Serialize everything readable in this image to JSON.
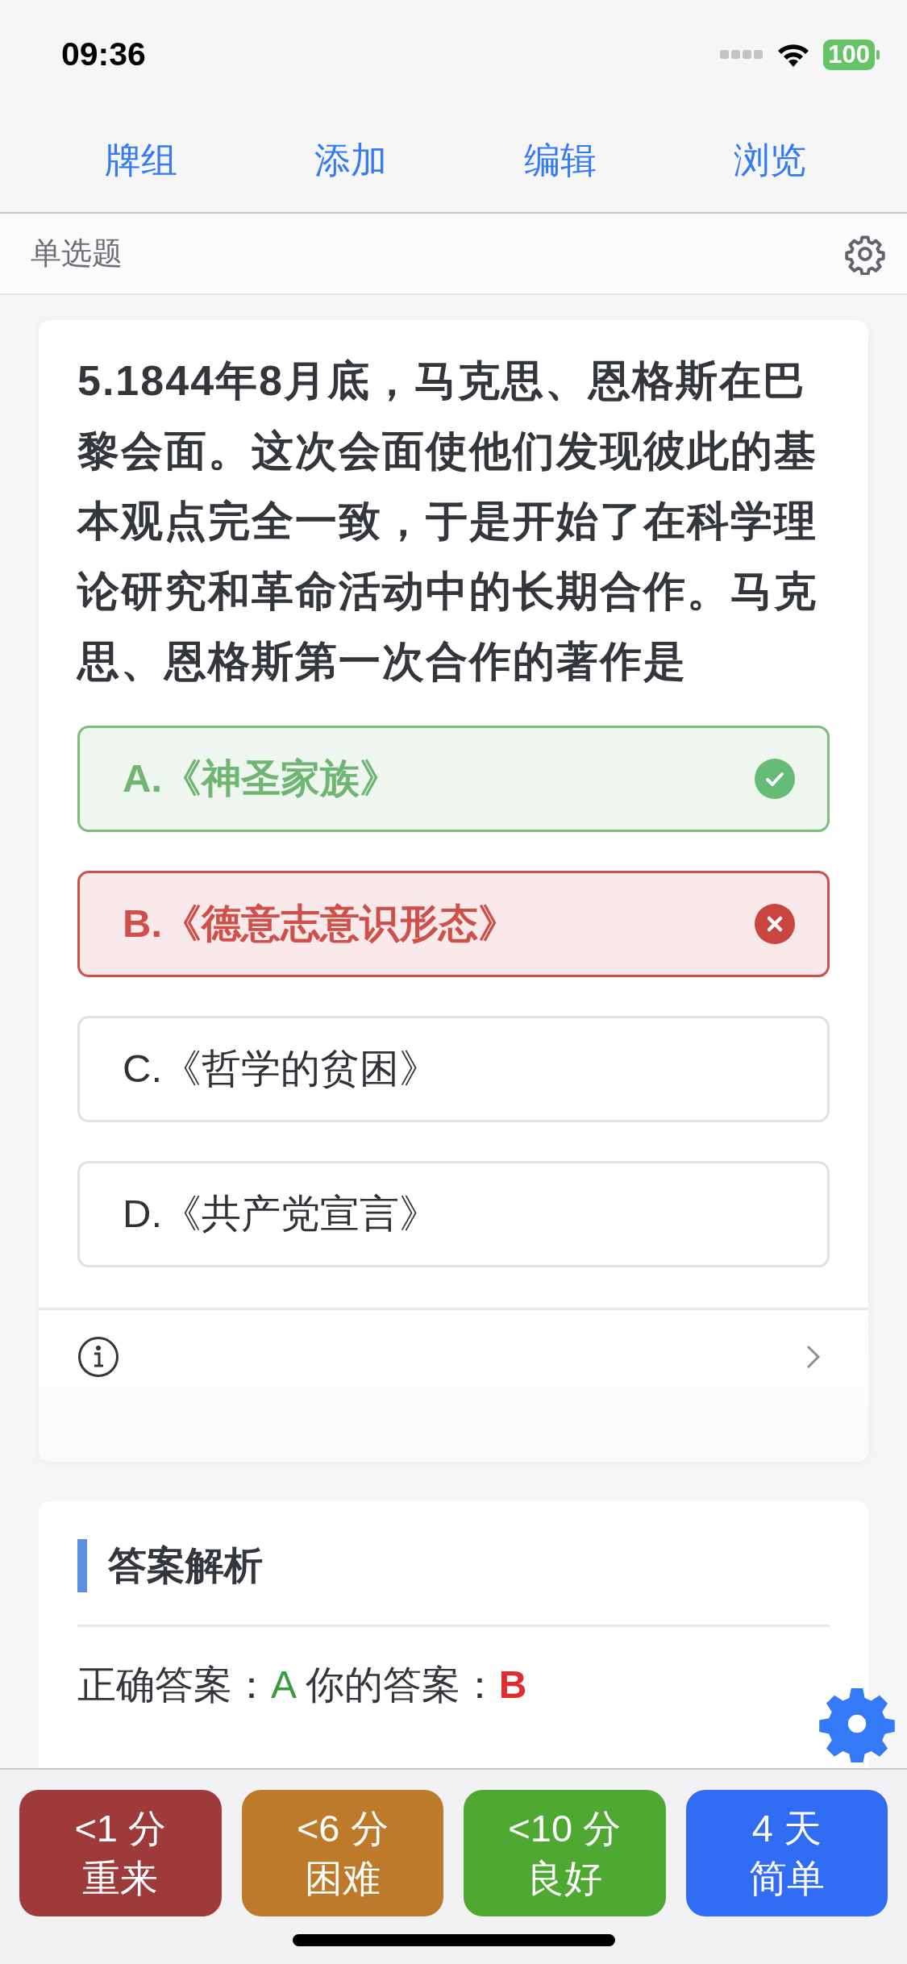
{
  "status_bar": {
    "time": "09:36",
    "battery": "100"
  },
  "nav": [
    {
      "label": "牌组"
    },
    {
      "label": "添加"
    },
    {
      "label": "编辑"
    },
    {
      "label": "浏览"
    }
  ],
  "subheader": {
    "title": "单选题"
  },
  "question": {
    "text": "5.1844年8月底，马克思、恩格斯在巴黎会面。这次会面使他们发现彼此的基本观点完全一致，于是开始了在科学理论研究和革命活动中的长期合作。马克思、恩格斯第一次合作的著作是",
    "options": [
      {
        "text": "A.《神圣家族》",
        "kind": "correct"
      },
      {
        "text": "B.《德意志意识形态》",
        "kind": "wrong"
      },
      {
        "text": "C.《哲学的贫困》",
        "kind": "plain"
      },
      {
        "text": "D.《共产党宣言》",
        "kind": "plain"
      }
    ]
  },
  "analysis": {
    "title": "答案解析",
    "correct_label": "正确答案：",
    "correct_value": "A",
    "yours_label": "你的答案：",
    "yours_value": "B"
  },
  "answer_buttons": [
    {
      "interval": "<1 分",
      "label": "重来",
      "color": "#9e3a3a"
    },
    {
      "interval": "<6 分",
      "label": "困难",
      "color": "#bd7a2a"
    },
    {
      "interval": "<10 分",
      "label": "良好",
      "color": "#4ea832"
    },
    {
      "interval": "4 天",
      "label": "简单",
      "color": "#316cf4"
    }
  ]
}
